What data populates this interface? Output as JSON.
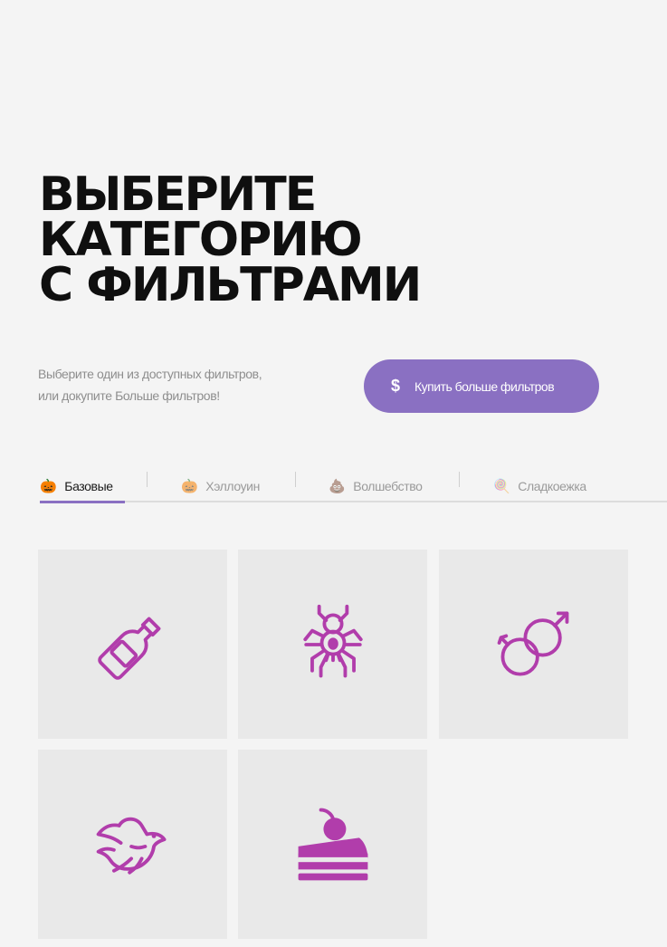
{
  "title": [
    "ВЫБЕРИТЕ",
    "КАТЕГОРИЮ",
    "С ФИЛЬТРАМИ"
  ],
  "subtitle": [
    "Выберите один из доступных фильтров,",
    "или докупите  Больше фильтров!"
  ],
  "buy_button": {
    "icon": "dollar-icon",
    "label": "Купить больше фильтров"
  },
  "tabs": [
    {
      "label": "Базовые",
      "icon": "pumpkin-icon",
      "glyph": "🎃",
      "active": true
    },
    {
      "label": "Хэллоуин",
      "icon": "pumpkin-icon",
      "glyph": "🎃",
      "active": false
    },
    {
      "label": "Волшебство",
      "icon": "poop-icon",
      "glyph": "💩",
      "active": false
    },
    {
      "label": "Сладкоежка",
      "icon": "lollipop-icon",
      "glyph": "🍭",
      "active": false
    }
  ],
  "filters": [
    {
      "icon": "bottle-icon"
    },
    {
      "icon": "spider-icon"
    },
    {
      "icon": "gender-symbols-icon"
    },
    {
      "icon": "dove-icon"
    },
    {
      "icon": "cake-icon"
    }
  ],
  "colors": {
    "accent": "#8a70c2",
    "icon": "#b13dab",
    "background": "#f4f4f4",
    "card": "#e9e9e9"
  }
}
